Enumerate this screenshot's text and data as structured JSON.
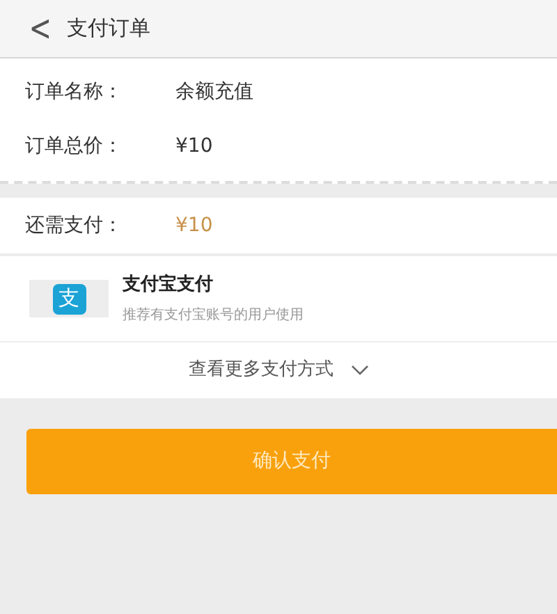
{
  "header": {
    "back": "<",
    "title": "支付订单"
  },
  "order": [
    {
      "label": "订单名称：",
      "value": "余额充值"
    },
    {
      "label": "订单总价：",
      "value": "¥10"
    }
  ],
  "due": {
    "label": "还需支付：",
    "value": "¥10"
  },
  "payment_methods": [
    {
      "icon_char": "支",
      "name": "支付宝支付",
      "description": "推荐有支付宝账号的用户使用"
    }
  ],
  "more_methods": "查看更多支付方式",
  "confirm_button": "确认支付"
}
